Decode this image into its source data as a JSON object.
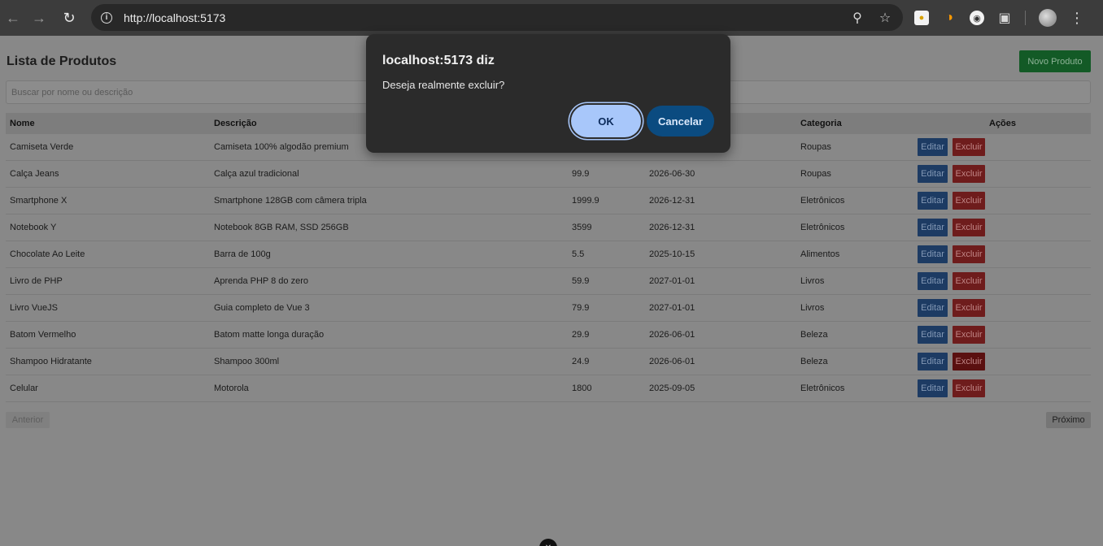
{
  "browser": {
    "url": "http://localhost:5173",
    "back_icon": "arrow-left-icon",
    "forward_icon": "arrow-right-icon",
    "reload_icon": "reload-icon"
  },
  "page": {
    "title": "Lista de Produtos",
    "new_button": "Novo Produto",
    "search_placeholder": "Buscar por nome ou descrição",
    "columns": [
      "Nome",
      "Descrição",
      "Categoria",
      "Ações"
    ],
    "rows": [
      {
        "nome": "Camiseta Verde",
        "descricao": "Camiseta 100% algodão premium",
        "preco": "",
        "validade": "",
        "categoria": "Roupas"
      },
      {
        "nome": "Calça Jeans",
        "descricao": "Calça azul tradicional",
        "preco": "99.9",
        "validade": "2026-06-30",
        "categoria": "Roupas"
      },
      {
        "nome": "Smartphone X",
        "descricao": "Smartphone 128GB com câmera tripla",
        "preco": "1999.9",
        "validade": "2026-12-31",
        "categoria": "Eletrônicos"
      },
      {
        "nome": "Notebook Y",
        "descricao": "Notebook 8GB RAM, SSD 256GB",
        "preco": "3599",
        "validade": "2026-12-31",
        "categoria": "Eletrônicos"
      },
      {
        "nome": "Chocolate Ao Leite",
        "descricao": "Barra de 100g",
        "preco": "5.5",
        "validade": "2025-10-15",
        "categoria": "Alimentos"
      },
      {
        "nome": "Livro de PHP",
        "descricao": "Aprenda PHP 8 do zero",
        "preco": "59.9",
        "validade": "2027-01-01",
        "categoria": "Livros"
      },
      {
        "nome": "Livro VueJS",
        "descricao": "Guia completo de Vue 3",
        "preco": "79.9",
        "validade": "2027-01-01",
        "categoria": "Livros"
      },
      {
        "nome": "Batom Vermelho",
        "descricao": "Batom matte longa duração",
        "preco": "29.9",
        "validade": "2026-06-01",
        "categoria": "Beleza"
      },
      {
        "nome": "Shampoo Hidratante",
        "descricao": "Shampoo 300ml",
        "preco": "24.9",
        "validade": "2026-06-01",
        "categoria": "Beleza"
      },
      {
        "nome": "Celular",
        "descricao": "Motorola",
        "preco": "1800",
        "validade": "2025-09-05",
        "categoria": "Eletrônicos"
      }
    ],
    "edit_label": "Editar",
    "delete_label": "Excluir",
    "prev_label": "Anterior",
    "next_label": "Próximo"
  },
  "dialog": {
    "title": "localhost:5173 diz",
    "message": "Deseja realmente excluir?",
    "ok_label": "OK",
    "cancel_label": "Cancelar"
  }
}
